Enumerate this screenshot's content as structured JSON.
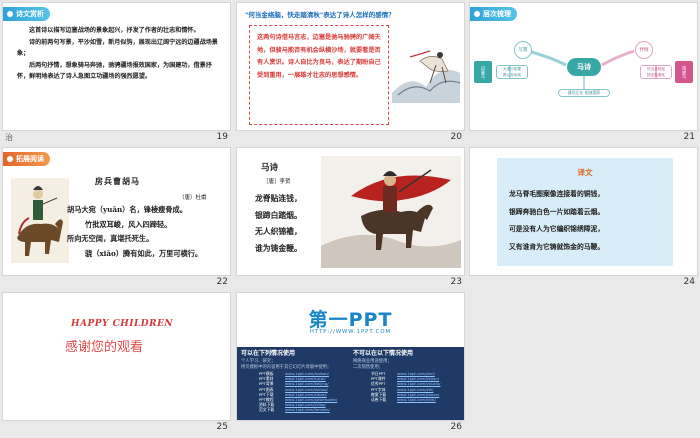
{
  "slides": [
    {
      "num": "19",
      "tag": "诗文赏析",
      "corner": "治",
      "paras": [
        "这首诗以描写边塞战场的景象起兴，抒发了作者的壮志和情怀。",
        "诗的前两句写景，平沙如雪，新月似钩，展现出辽阔宁远的边疆战场景象；",
        "后两句抒情，想象骑马奔驰，驰骋疆场报效国家，为国建功，借景抒怀，鲜明地表达了诗人急图立功疆场的强烈愿望。"
      ]
    },
    {
      "num": "20",
      "question": "\"何当金络脑，快走踏清秋\"表达了诗人怎样的感情？",
      "answer": "这两句诗借马言志，边塞是驰马驰骋的广阔天地，但骏马能否有机会纵横沙场，就要看是否有人赏识。诗人自比为良马，表达了期盼自己受到重用，一展雄才壮志的思想感情。"
    },
    {
      "num": "21",
      "tag": "层次梳理",
      "center": "马诗",
      "left_top": "写景",
      "right_top": "抒情",
      "left_side": "边塞马",
      "right_side": "渴望马",
      "left_detail": [
        "大漠沙如雪",
        "燕山月似钩"
      ],
      "right_detail": [
        "何当金络脑",
        "快走踏清秋"
      ],
      "bottom": [
        "建功立业",
        "报效国家"
      ]
    },
    {
      "num": "22",
      "tag": "拓展阅读",
      "title": "房兵曹胡马",
      "author": "（唐）杜甫",
      "lines": [
        "胡马大宛（yuān）名，锋棱瘦骨成。",
        "竹批双耳峻，风入四蹄轻。",
        "所向无空阔，真堪托死生。",
        "骁（xiāo）腾有如此，万里可横行。"
      ]
    },
    {
      "num": "23",
      "title": "马诗",
      "author": "［唐］李贺",
      "lines": [
        "龙脊贴连钱，",
        "银蹄白踏烟。",
        "无人织锦襜，",
        "谁为铸金鞭。"
      ]
    },
    {
      "num": "24",
      "title": "译文",
      "lines": [
        "龙马脊毛图案像连接着的铜钱，",
        "银蹄奔驰白色一片如踏着云烟。",
        "可是没有人为它编织锦绣障泥，",
        "又有谁肯为它铸就饰金的马鞭。"
      ]
    },
    {
      "num": "25",
      "happy": "HAPPY CHILDREN",
      "thanks": "感谢您的观看"
    },
    {
      "num": "26",
      "logo": "第一PPT",
      "url": "HTTP://WWW.1PPT.COM",
      "left_head": "可以在下列情况使用",
      "left_sub": [
        "个人学习、研究；",
        "拷贝模板中的内容用于其它幻灯片母版中使用；"
      ],
      "right_head": "不可以在以下情况使用",
      "right_sub": [
        "网络商业用途使用；",
        "二次销售使用；"
      ],
      "left_links": [
        [
          "PPT模板",
          "www.1ppt.com/moban/"
        ],
        [
          "PPT素材",
          "www.1ppt.com/sucai/"
        ],
        [
          "PPT背景",
          "www.1ppt.com/beijing/"
        ],
        [
          "PPT图表",
          "www.1ppt.com/tubiao/"
        ],
        [
          "PPT下载",
          "www.1ppt.com/xiazai/"
        ],
        [
          "PPT教程",
          "www.1ppt.com/powerpoint/"
        ],
        [
          "资料下载",
          "www.1ppt.com/ziliao/"
        ],
        [
          "范文下载",
          "www.1ppt.com/fanwen/"
        ]
      ],
      "right_links": [
        [
          "节日PPT",
          "www.1ppt.com/jieri/"
        ],
        [
          "PPT课件",
          "www.1ppt.com/kejian/"
        ],
        [
          "优秀PPT",
          "www.1ppt.com/youxiu/"
        ],
        [
          "PPT字体",
          "www.1ppt.com/ziti/"
        ],
        [
          "教案下载",
          "www.1ppt.com/jiaoan/"
        ],
        [
          "试卷下载",
          "www.1ppt.com/shiti/"
        ]
      ]
    }
  ]
}
